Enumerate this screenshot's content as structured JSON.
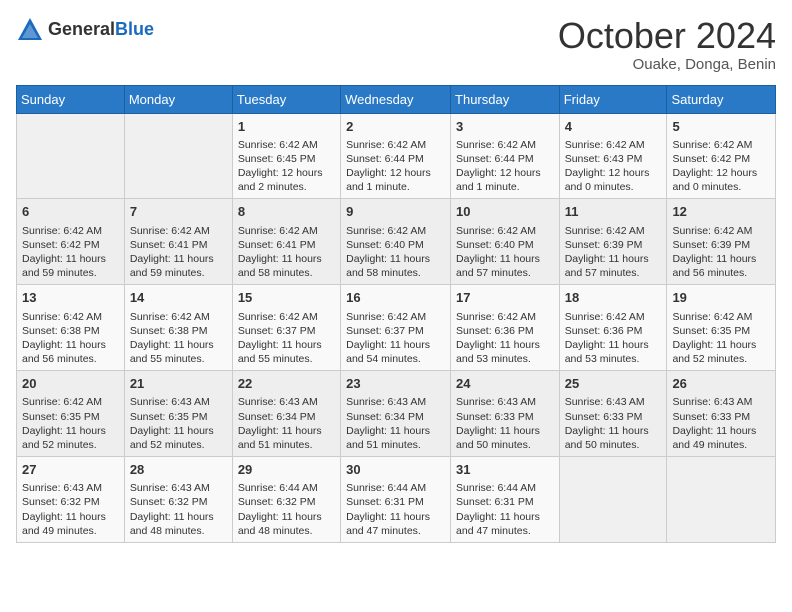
{
  "header": {
    "logo_general": "General",
    "logo_blue": "Blue",
    "month": "October 2024",
    "location": "Ouake, Donga, Benin"
  },
  "days_of_week": [
    "Sunday",
    "Monday",
    "Tuesday",
    "Wednesday",
    "Thursday",
    "Friday",
    "Saturday"
  ],
  "weeks": [
    [
      {
        "day": "",
        "content": ""
      },
      {
        "day": "",
        "content": ""
      },
      {
        "day": "1",
        "content": "Sunrise: 6:42 AM\nSunset: 6:45 PM\nDaylight: 12 hours and 2 minutes."
      },
      {
        "day": "2",
        "content": "Sunrise: 6:42 AM\nSunset: 6:44 PM\nDaylight: 12 hours and 1 minute."
      },
      {
        "day": "3",
        "content": "Sunrise: 6:42 AM\nSunset: 6:44 PM\nDaylight: 12 hours and 1 minute."
      },
      {
        "day": "4",
        "content": "Sunrise: 6:42 AM\nSunset: 6:43 PM\nDaylight: 12 hours and 0 minutes."
      },
      {
        "day": "5",
        "content": "Sunrise: 6:42 AM\nSunset: 6:42 PM\nDaylight: 12 hours and 0 minutes."
      }
    ],
    [
      {
        "day": "6",
        "content": "Sunrise: 6:42 AM\nSunset: 6:42 PM\nDaylight: 11 hours and 59 minutes."
      },
      {
        "day": "7",
        "content": "Sunrise: 6:42 AM\nSunset: 6:41 PM\nDaylight: 11 hours and 59 minutes."
      },
      {
        "day": "8",
        "content": "Sunrise: 6:42 AM\nSunset: 6:41 PM\nDaylight: 11 hours and 58 minutes."
      },
      {
        "day": "9",
        "content": "Sunrise: 6:42 AM\nSunset: 6:40 PM\nDaylight: 11 hours and 58 minutes."
      },
      {
        "day": "10",
        "content": "Sunrise: 6:42 AM\nSunset: 6:40 PM\nDaylight: 11 hours and 57 minutes."
      },
      {
        "day": "11",
        "content": "Sunrise: 6:42 AM\nSunset: 6:39 PM\nDaylight: 11 hours and 57 minutes."
      },
      {
        "day": "12",
        "content": "Sunrise: 6:42 AM\nSunset: 6:39 PM\nDaylight: 11 hours and 56 minutes."
      }
    ],
    [
      {
        "day": "13",
        "content": "Sunrise: 6:42 AM\nSunset: 6:38 PM\nDaylight: 11 hours and 56 minutes."
      },
      {
        "day": "14",
        "content": "Sunrise: 6:42 AM\nSunset: 6:38 PM\nDaylight: 11 hours and 55 minutes."
      },
      {
        "day": "15",
        "content": "Sunrise: 6:42 AM\nSunset: 6:37 PM\nDaylight: 11 hours and 55 minutes."
      },
      {
        "day": "16",
        "content": "Sunrise: 6:42 AM\nSunset: 6:37 PM\nDaylight: 11 hours and 54 minutes."
      },
      {
        "day": "17",
        "content": "Sunrise: 6:42 AM\nSunset: 6:36 PM\nDaylight: 11 hours and 53 minutes."
      },
      {
        "day": "18",
        "content": "Sunrise: 6:42 AM\nSunset: 6:36 PM\nDaylight: 11 hours and 53 minutes."
      },
      {
        "day": "19",
        "content": "Sunrise: 6:42 AM\nSunset: 6:35 PM\nDaylight: 11 hours and 52 minutes."
      }
    ],
    [
      {
        "day": "20",
        "content": "Sunrise: 6:42 AM\nSunset: 6:35 PM\nDaylight: 11 hours and 52 minutes."
      },
      {
        "day": "21",
        "content": "Sunrise: 6:43 AM\nSunset: 6:35 PM\nDaylight: 11 hours and 52 minutes."
      },
      {
        "day": "22",
        "content": "Sunrise: 6:43 AM\nSunset: 6:34 PM\nDaylight: 11 hours and 51 minutes."
      },
      {
        "day": "23",
        "content": "Sunrise: 6:43 AM\nSunset: 6:34 PM\nDaylight: 11 hours and 51 minutes."
      },
      {
        "day": "24",
        "content": "Sunrise: 6:43 AM\nSunset: 6:33 PM\nDaylight: 11 hours and 50 minutes."
      },
      {
        "day": "25",
        "content": "Sunrise: 6:43 AM\nSunset: 6:33 PM\nDaylight: 11 hours and 50 minutes."
      },
      {
        "day": "26",
        "content": "Sunrise: 6:43 AM\nSunset: 6:33 PM\nDaylight: 11 hours and 49 minutes."
      }
    ],
    [
      {
        "day": "27",
        "content": "Sunrise: 6:43 AM\nSunset: 6:32 PM\nDaylight: 11 hours and 49 minutes."
      },
      {
        "day": "28",
        "content": "Sunrise: 6:43 AM\nSunset: 6:32 PM\nDaylight: 11 hours and 48 minutes."
      },
      {
        "day": "29",
        "content": "Sunrise: 6:44 AM\nSunset: 6:32 PM\nDaylight: 11 hours and 48 minutes."
      },
      {
        "day": "30",
        "content": "Sunrise: 6:44 AM\nSunset: 6:31 PM\nDaylight: 11 hours and 47 minutes."
      },
      {
        "day": "31",
        "content": "Sunrise: 6:44 AM\nSunset: 6:31 PM\nDaylight: 11 hours and 47 minutes."
      },
      {
        "day": "",
        "content": ""
      },
      {
        "day": "",
        "content": ""
      }
    ]
  ]
}
